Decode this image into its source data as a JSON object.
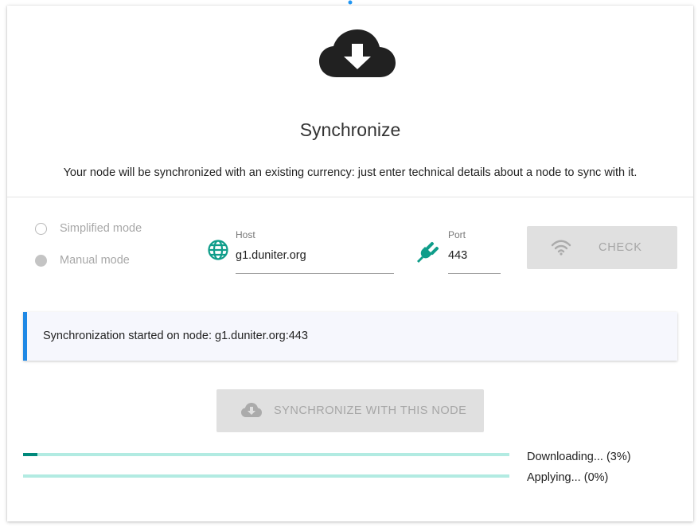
{
  "header": {
    "icon": "cloud-download-icon",
    "title": "Synchronize",
    "description": "Your node will be synchronized with an existing currency: just enter technical details about a node to sync with it."
  },
  "mode": {
    "options": [
      {
        "label": "Simplified mode",
        "selected": false
      },
      {
        "label": "Manual mode",
        "selected": true
      }
    ]
  },
  "host": {
    "icon": "globe-icon",
    "label": "Host",
    "value": "g1.duniter.org"
  },
  "port": {
    "icon": "plug-icon",
    "label": "Port",
    "value": "443"
  },
  "check_button": {
    "icon": "wifi-icon",
    "label": "CHECK"
  },
  "notice": {
    "text": "Synchronization started on node: g1.duniter.org:443",
    "accent": "#1e88e5"
  },
  "sync_button": {
    "icon": "cloud-download-icon",
    "label": "SYNCHRONIZE WITH THIS NODE"
  },
  "progress": [
    {
      "label": "Downloading... (3%)",
      "percent": 3
    },
    {
      "label": "Applying... (0%)",
      "percent": 0
    }
  ],
  "colors": {
    "progress_fill": "#00897b",
    "progress_track": "#b2ebe2",
    "icon_teal": "#0f9d8a"
  }
}
